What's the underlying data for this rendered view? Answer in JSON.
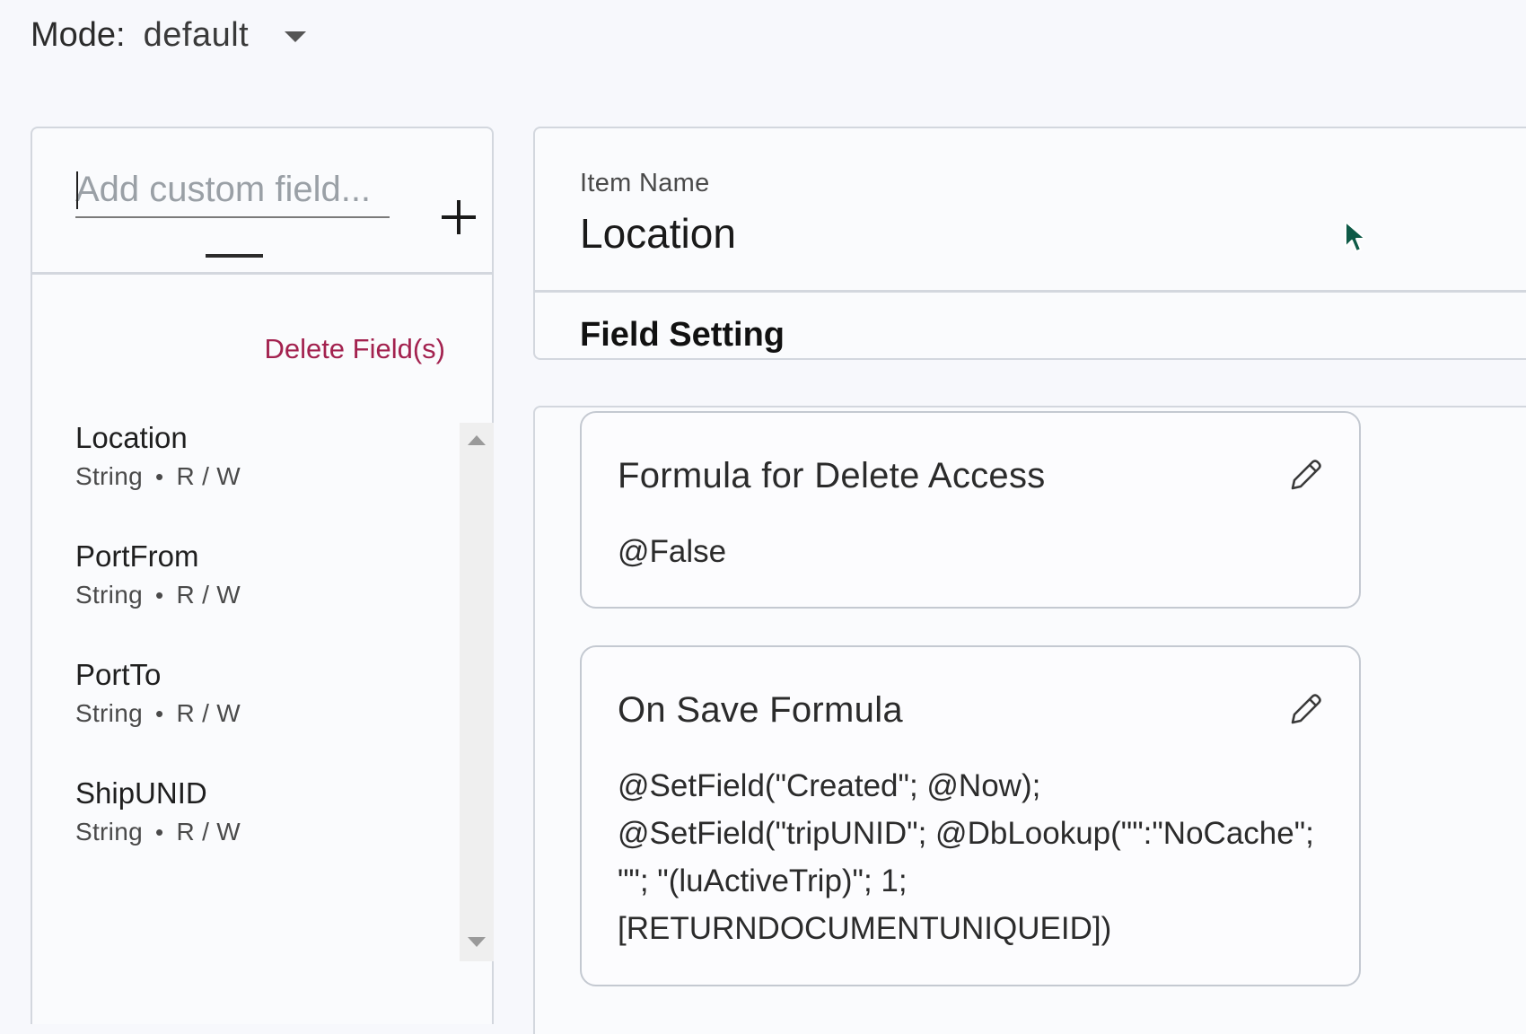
{
  "mode": {
    "label": "Mode:",
    "value": "default"
  },
  "left_panel": {
    "add_field_placeholder": "Add custom field...",
    "add_field_value": "",
    "add_icon": "plus-icon",
    "delete_label": "Delete Field(s)",
    "fields": [
      {
        "name": "Location",
        "type": "String",
        "access": "R / W"
      },
      {
        "name": "PortFrom",
        "type": "String",
        "access": "R / W"
      },
      {
        "name": "PortTo",
        "type": "String",
        "access": "R / W"
      },
      {
        "name": "ShipUNID",
        "type": "String",
        "access": "R / W"
      }
    ],
    "separator": "•"
  },
  "header": {
    "item_name_label": "Item Name",
    "item_name_value": "Location",
    "section_title": "Field Setting"
  },
  "formulas": [
    {
      "title": "Formula for Delete Access",
      "body": "@False",
      "edit_icon": "pencil-icon"
    },
    {
      "title": "On Save Formula",
      "body": "@SetField(\"Created\"; @Now);\n@SetField(\"tripUNID\"; @DbLookup(\"\":\"NoCache\";\n\"\"; \"(luActiveTrip)\"; 1;\n[RETURNDOCUMENTUNIQUEID])",
      "edit_icon": "pencil-icon"
    }
  ],
  "colors": {
    "background": "#f7f8fc",
    "panel_border": "#d3d7de",
    "delete_accent": "#a3224f",
    "cursor_fill": "#0e5a47"
  }
}
